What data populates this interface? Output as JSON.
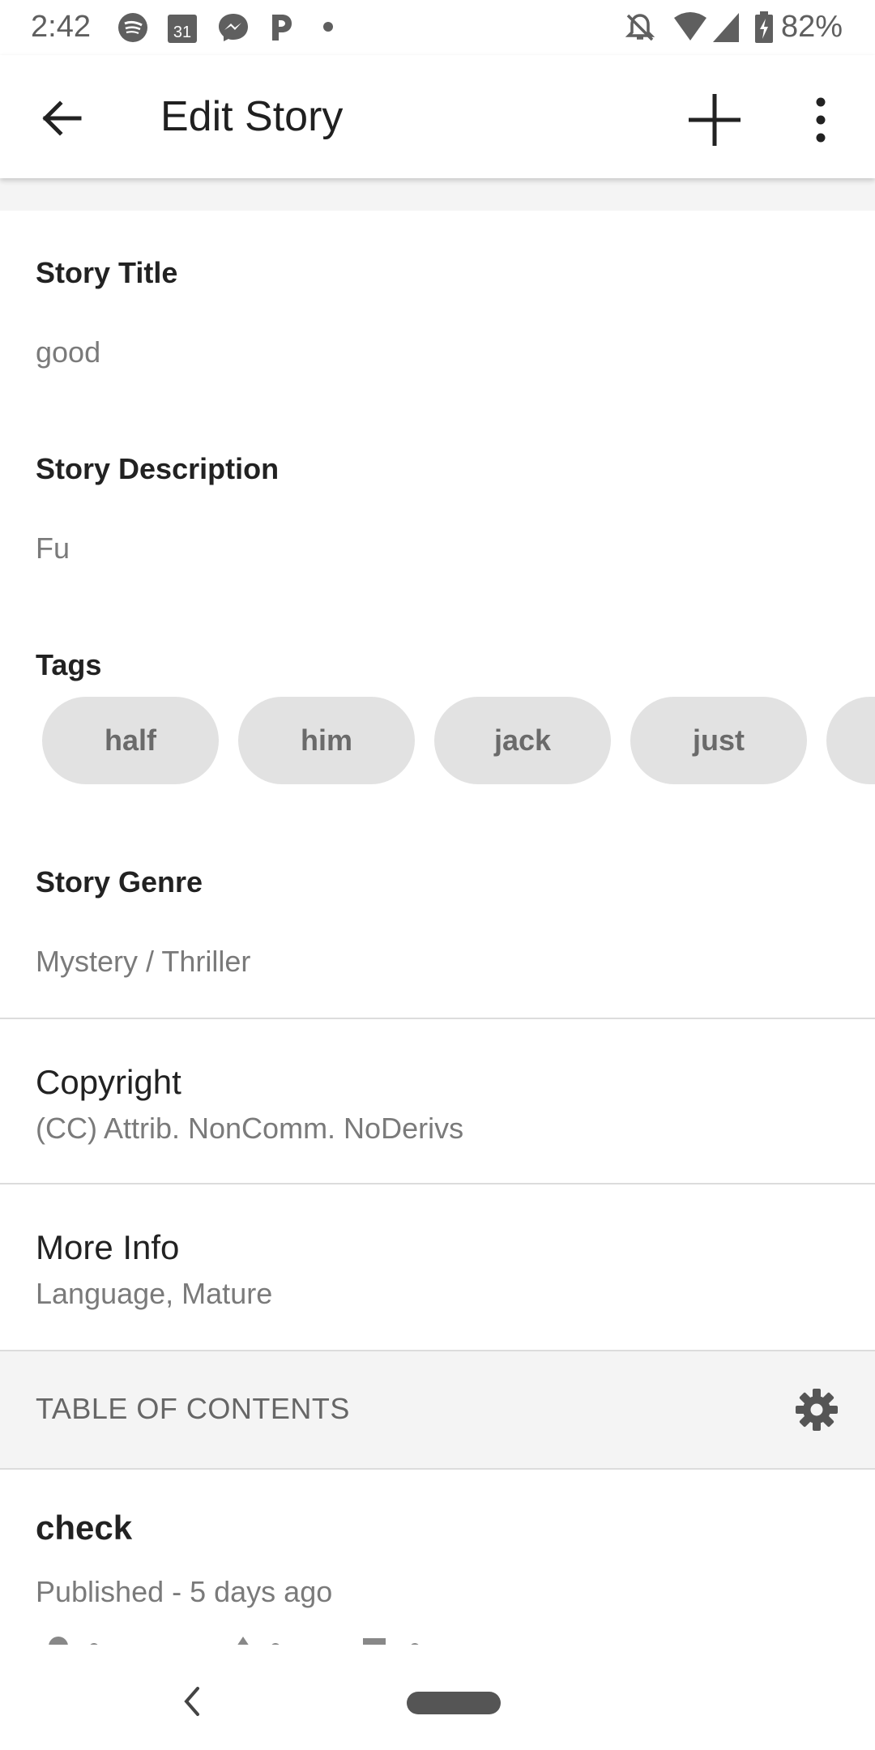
{
  "status_bar": {
    "time": "2:42",
    "battery": "82%",
    "icons": [
      "spotify-icon",
      "calendar-icon",
      "messenger-icon",
      "pandora-icon",
      "dot-icon",
      "mute-icon",
      "wifi-icon",
      "signal-icon",
      "battery-icon"
    ],
    "calendar_day": "31"
  },
  "app_bar": {
    "title": "Edit Story",
    "back_icon": "back-arrow-icon",
    "add_icon": "plus-icon",
    "menu_icon": "more-vert-icon"
  },
  "story": {
    "title_label": "Story Title",
    "title_value": "good",
    "description_label": "Story Description",
    "description_value": "Fu",
    "tags_label": "Tags",
    "tags": [
      "half",
      "him",
      "jack",
      "just",
      ""
    ],
    "genre_label": "Story Genre",
    "genre_value": "Mystery / Thriller"
  },
  "copyright": {
    "title": "Copyright",
    "value": "(CC) Attrib. NonComm. NoDerivs"
  },
  "more_info": {
    "title": "More Info",
    "value": "Language, Mature"
  },
  "toc": {
    "label": "TABLE OF CONTENTS",
    "settings_icon": "gear-icon"
  },
  "parts": [
    {
      "title": "check",
      "status": "Published - 5 days ago"
    }
  ],
  "colors": {
    "tag_bg": "#e2e2e2",
    "section_bg": "#f4f4f4",
    "muted_text": "#7a7a7a"
  }
}
